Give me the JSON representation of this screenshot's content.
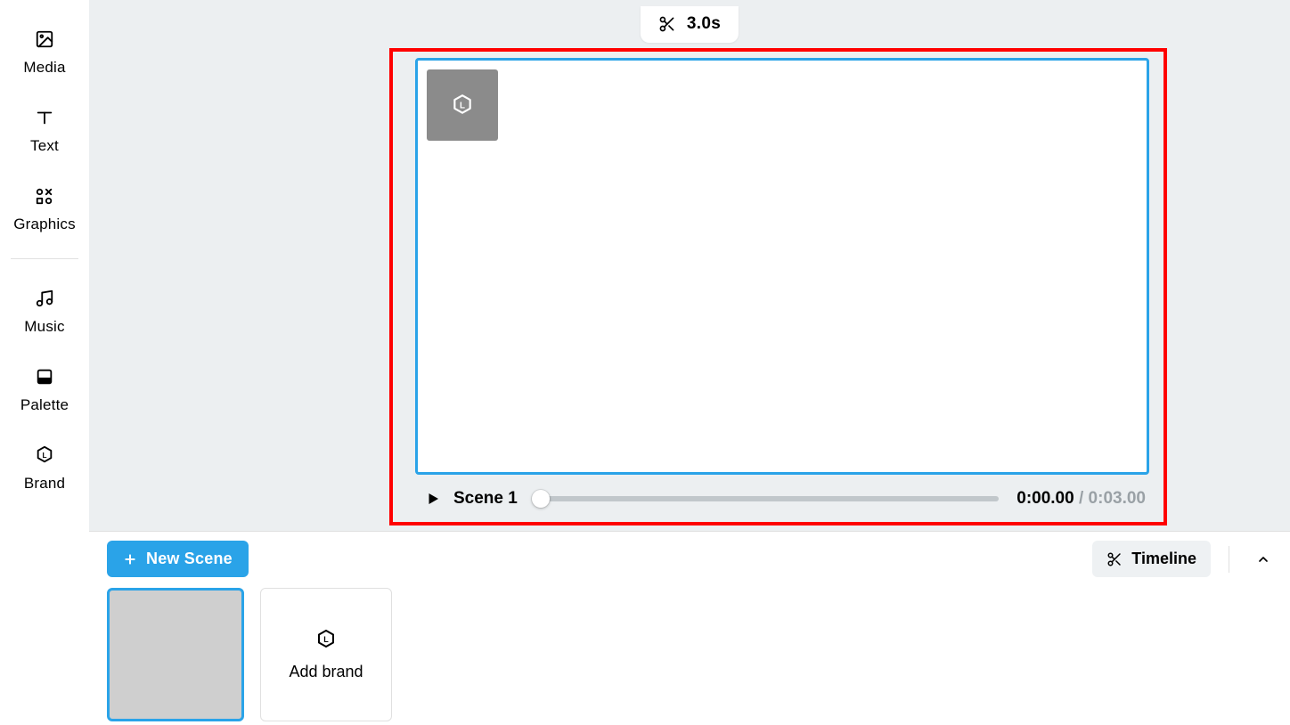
{
  "sidebar": {
    "items": [
      {
        "label": "Media"
      },
      {
        "label": "Text"
      },
      {
        "label": "Graphics"
      },
      {
        "label": "Music"
      },
      {
        "label": "Palette"
      },
      {
        "label": "Brand"
      }
    ]
  },
  "trim": {
    "duration_label": "3.0s"
  },
  "player": {
    "scene_label": "Scene 1",
    "current_time": "0:00.00",
    "separator": " / ",
    "total_time": "0:03.00"
  },
  "bottom": {
    "new_scene_label": "New Scene",
    "timeline_label": "Timeline",
    "add_brand_label": "Add brand"
  }
}
